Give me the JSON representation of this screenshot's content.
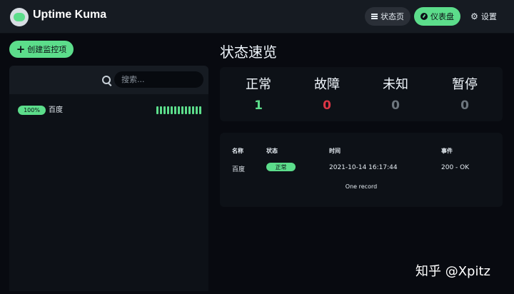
{
  "header": {
    "app_title": "Uptime Kuma",
    "nav": {
      "status_page": "状态页",
      "dashboard": "仪表盘",
      "settings": "设置"
    }
  },
  "sidebar": {
    "create_monitor_label": "创建监控项",
    "search_placeholder": "搜索...",
    "monitors": [
      {
        "name": "百度",
        "uptime": "100%",
        "heartbeats_up": 13
      }
    ]
  },
  "main": {
    "quick_stats_title": "状态速览",
    "stats": [
      {
        "label": "正常",
        "value": "1",
        "color": "#5cdd8b"
      },
      {
        "label": "故障",
        "value": "0",
        "color": "#dc3545"
      },
      {
        "label": "未知",
        "value": "0",
        "color": "#6c757d"
      },
      {
        "label": "暂停",
        "value": "0",
        "color": "#6c757d"
      }
    ],
    "events": {
      "columns": [
        "名称",
        "状态",
        "时间",
        "事件"
      ],
      "rows": [
        {
          "name": "百度",
          "status": "正常",
          "time": "2021-10-14 16:17:44",
          "message": "200 - OK"
        }
      ],
      "record_count": "One record"
    }
  },
  "watermark": "知乎 @Xpitz",
  "colors": {
    "accent": "#5cdd8b",
    "danger": "#dc3545",
    "muted": "#6c757d"
  }
}
